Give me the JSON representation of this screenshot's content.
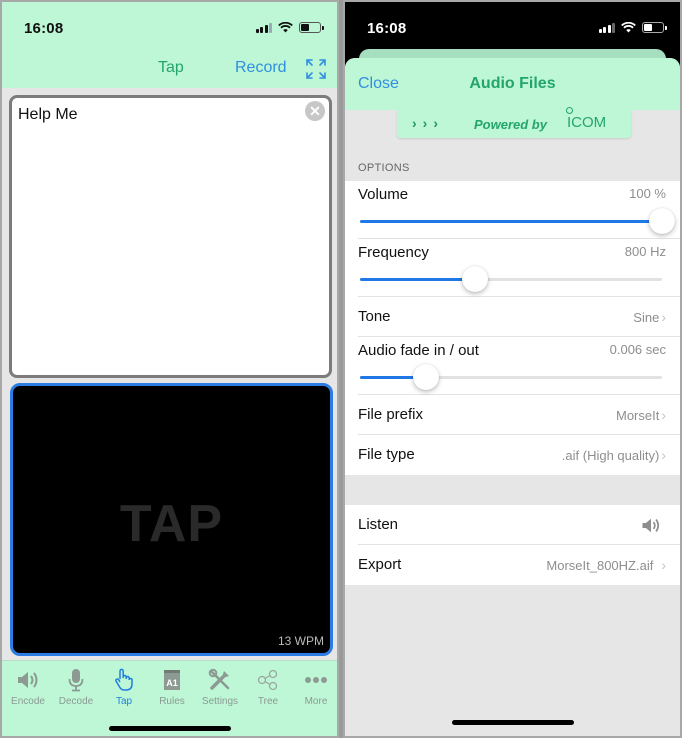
{
  "left": {
    "status": {
      "time": "16:08"
    },
    "nav": {
      "tap_title": "Tap",
      "record_label": "Record",
      "expand_icon": "expand-arrows-icon"
    },
    "textbox": {
      "value": "Help Me",
      "clear_icon": "clear-x-icon"
    },
    "tappad": {
      "label": "TAP",
      "speed": "13 WPM"
    },
    "tabs": [
      {
        "label": "Encode",
        "icon": "speaker-icon",
        "active": false
      },
      {
        "label": "Decode",
        "icon": "microphone-icon",
        "active": false
      },
      {
        "label": "Tap",
        "icon": "hand-pointer-icon",
        "active": true
      },
      {
        "label": "Rules",
        "icon": "rules-book-icon",
        "active": false
      },
      {
        "label": "Settings",
        "icon": "tools-icon",
        "active": false
      },
      {
        "label": "Tree",
        "icon": "share-tree-icon",
        "active": false
      },
      {
        "label": "More",
        "icon": "more-dots-icon",
        "active": false
      }
    ]
  },
  "right": {
    "status": {
      "time": "16:08"
    },
    "header": {
      "close_label": "Close",
      "title": "Audio Files"
    },
    "banner": {
      "chevrons": "›››",
      "powered_by": "Powered by",
      "brand": "ICOM"
    },
    "options_header": "OPTIONS",
    "options": {
      "volume": {
        "label": "Volume",
        "value": "100 %",
        "fraction": 1.0
      },
      "frequency": {
        "label": "Frequency",
        "value": "800 Hz",
        "fraction": 0.38
      },
      "tone": {
        "label": "Tone",
        "value": "Sine"
      },
      "fade": {
        "label": "Audio fade in / out",
        "value": "0.006 sec",
        "fraction": 0.22
      },
      "file_prefix": {
        "label": "File prefix",
        "value": "MorseIt"
      },
      "file_type": {
        "label": "File type",
        "value": ".aif (High quality)"
      }
    },
    "actions": {
      "listen": {
        "label": "Listen",
        "icon": "speaker-icon"
      },
      "export": {
        "label": "Export",
        "value": "MorseIt_800HZ.aif"
      }
    }
  },
  "colors": {
    "accent_green": "#25a56a",
    "accent_blue": "#2f8fe0",
    "header_bg": "#bdf7d6",
    "slider_blue": "#1f78e6"
  }
}
